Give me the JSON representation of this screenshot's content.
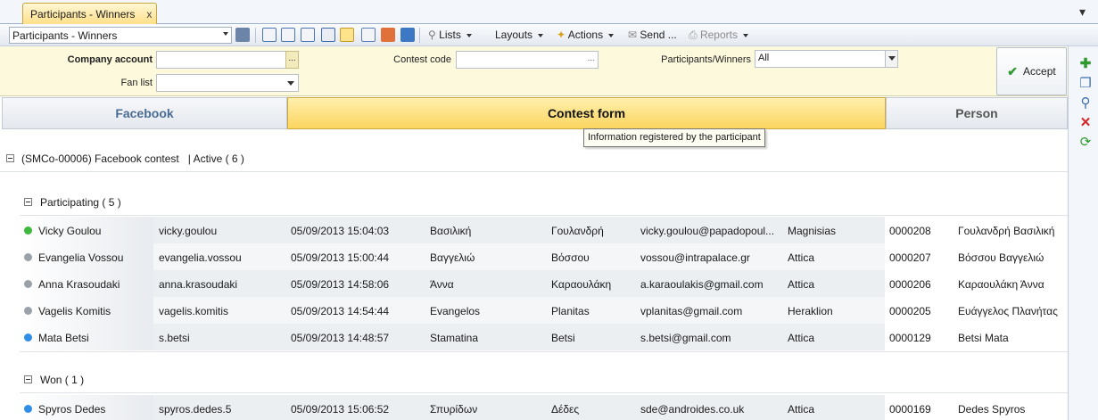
{
  "window": {
    "tab_label": "Participants - Winners",
    "tab_close": "x",
    "close_glyph": "▾"
  },
  "toolbar": {
    "view_select_value": "Participants - Winners",
    "lists_label": "Lists",
    "layouts_label": "Layouts",
    "actions_label": "Actions",
    "send_label": "Send ...",
    "reports_label": "Reports"
  },
  "filters": {
    "company_account_label": "Company account",
    "company_account_value": "",
    "fan_list_label": "Fan list",
    "fan_list_value": "",
    "contest_code_label": "Contest code",
    "contest_code_value": "",
    "participants_winners_label": "Participants/Winners",
    "participants_winners_value": "All",
    "ellipsis": "...",
    "accept_label": "Accept"
  },
  "tabs": {
    "facebook": "Facebook",
    "contest_form": "Contest form",
    "person": "Person"
  },
  "tooltip": "Information registered by the participant",
  "contest": {
    "header": "(SMCo-00006) Facebook contest",
    "status": "| Active ( 6 )"
  },
  "groups": {
    "participating": {
      "label": "Participating ( 5 )",
      "rows": [
        {
          "name": "Vicky Goulou",
          "username": "vicky.goulou",
          "datetime": "05/09/2013 15:04:03",
          "first": "Βασιλική",
          "last": "Γουλανδρή",
          "email": "vicky.goulou@papadopoul...",
          "region": "Magnisias",
          "code": "0000208",
          "full": "Γουλανδρή Βασιλική",
          "dot": "#3dba3d"
        },
        {
          "name": "Evangelia Vossou",
          "username": "evangelia.vossou",
          "datetime": "05/09/2013 15:00:44",
          "first": "Βαγγελιώ",
          "last": "Βόσσου",
          "email": "vossou@intrapalace.gr",
          "region": "Attica",
          "code": "0000207",
          "full": "Βόσσου Βαγγελιώ",
          "dot": "#9aa2a8"
        },
        {
          "name": "Anna Krasoudaki",
          "username": "anna.krasoudaki",
          "datetime": "05/09/2013 14:58:06",
          "first": "Άννα",
          "last": "Καραουλάκη",
          "email": "a.karaoulakis@gmail.com",
          "region": "Attica",
          "code": "0000206",
          "full": "Καραουλάκη Άννα",
          "dot": "#9aa2a8"
        },
        {
          "name": "Vagelis Komitis",
          "username": "vagelis.komitis",
          "datetime": "05/09/2013 14:54:44",
          "first": "Evangelos",
          "last": "Planitas",
          "email": "vplanitas@gmail.com",
          "region": "Heraklion",
          "code": "0000205",
          "full": "Ευάγγελος Πλανήτας",
          "dot": "#9aa2a8"
        },
        {
          "name": "Mata Betsi",
          "username": "s.betsi",
          "datetime": "05/09/2013 14:48:57",
          "first": "Stamatina",
          "last": "Betsi",
          "email": "s.betsi@gmail.com",
          "region": "Attica",
          "code": "0000129",
          "full": "Betsi Mata",
          "dot": "#2f8ee8"
        }
      ]
    },
    "won": {
      "label": "Won ( 1 )",
      "rows": [
        {
          "name": "Spyros Dedes",
          "username": "spyros.dedes.5",
          "datetime": "05/09/2013 15:06:52",
          "first": "Σπυρίδων",
          "last": "Δέδες",
          "email": "sde@androides.co.uk",
          "region": "Attica",
          "code": "0000169",
          "full": "Dedes Spyros",
          "dot": "#2f8ee8"
        }
      ]
    }
  }
}
